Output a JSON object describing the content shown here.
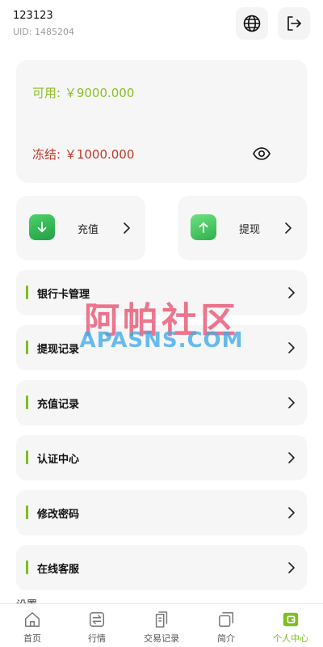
{
  "header": {
    "username": "123123",
    "uid": "UID: 1485204",
    "globe_icon": "globe-icon",
    "logout_icon": "logout-icon"
  },
  "balance": {
    "available": "可用: ￥9000.000",
    "frozen": "冻结: ￥1000.000",
    "eye_icon": "eye-icon"
  },
  "actions": [
    {
      "label": "充值",
      "icon": "arrow-down-icon"
    },
    {
      "label": "提现",
      "icon": "arrow-up-icon"
    }
  ],
  "menu": [
    {
      "label": "银行卡管理"
    },
    {
      "label": "提现记录"
    },
    {
      "label": "充值记录"
    },
    {
      "label": "认证中心"
    },
    {
      "label": "修改密码"
    },
    {
      "label": "在线客服"
    }
  ],
  "settings_peek": "设置",
  "watermark": {
    "cn": "阿帕社区",
    "en": "APASNS.COM"
  },
  "bottom_nav": [
    {
      "label": "首页",
      "icon": "home-icon"
    },
    {
      "label": "行情",
      "icon": "swap-icon"
    },
    {
      "label": "交易记录",
      "icon": "document-icon"
    },
    {
      "label": "简介",
      "icon": "copy-icon"
    },
    {
      "label": "个人中心",
      "icon": "wallet-icon",
      "active": true
    }
  ],
  "colors": {
    "accent": "#7cbf1f",
    "available": "#8cbf26",
    "frozen": "#c0392b",
    "card_bg": "#f6f6f6"
  }
}
